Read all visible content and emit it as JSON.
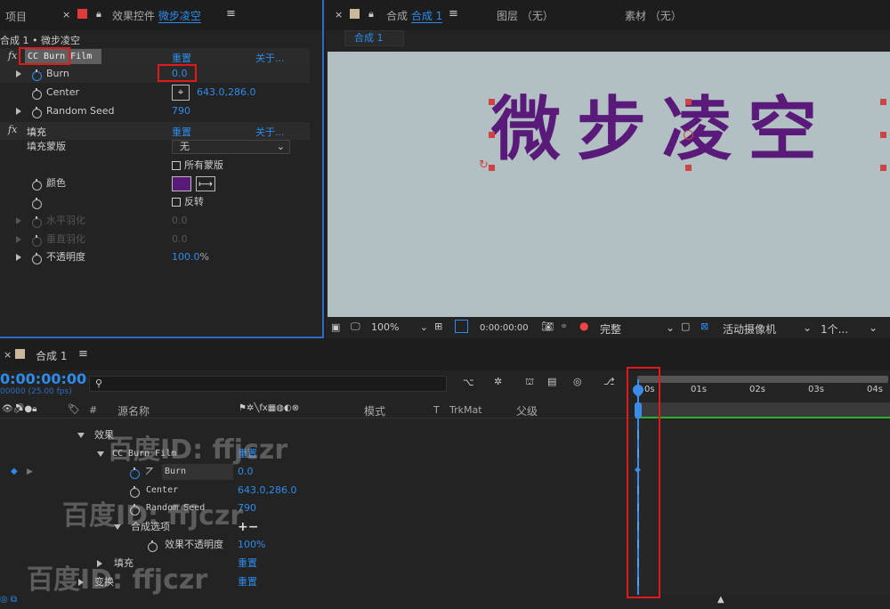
{
  "left_panel": {
    "tab_project": "项目",
    "tab_effects": "效果控件",
    "tab_effects_layer": "微步凌空",
    "breadcrumb": "合成 1 • 微步凌空",
    "fx_label": "fx",
    "effect1_name": "CC Burn Film",
    "reset": "重置",
    "about": "关于...",
    "burn_label": "Burn",
    "burn_value": "0.0",
    "center_label": "Center",
    "center_value": "643.0,286.0",
    "seed_label": "Random Seed",
    "seed_value": "790",
    "effect2_name": "填充",
    "mask_label": "填充蒙版",
    "mask_value": "无",
    "all_masks": "所有蒙版",
    "color_label": "颜色",
    "invert": "反转",
    "h_feather": "水平羽化",
    "h_feather_value": "0.0",
    "v_feather": "垂直羽化",
    "v_feather_value": "0.0",
    "opacity_label": "不透明度",
    "opacity_value": "100.0",
    "opacity_unit": "%",
    "fill_color": "#5a1a7a"
  },
  "comp_panel": {
    "tab_prefix": "合成",
    "tab_comp": "合成 1",
    "tab_layer": "图层 （无）",
    "tab_footage": "素材 （无）",
    "subtab": "合成 1",
    "canvas_text": "微步凌空",
    "zoom": "100%",
    "timecode": "0:00:00:00",
    "resolution": "完整",
    "camera": "活动摄像机",
    "views": "1个...",
    "text_color": "#5a1a7a",
    "canvas_bg": "#b3c0c3"
  },
  "timeline": {
    "tab": "合成 1",
    "timecode": "0:00:00:00",
    "fps": "00000 (25.00 fps)",
    "search_placeholder": "",
    "col_source": "源名称",
    "col_mode": "模式",
    "col_t": "T",
    "col_trkmat": "TrkMat",
    "col_parent": "父级",
    "ruler": [
      "0s",
      "01s",
      "02s",
      "03s",
      "04s"
    ],
    "rows": {
      "effects": "效果",
      "burn_film": "CC Burn Film",
      "burn": "Burn",
      "center": "Center",
      "seed": "Random Seed",
      "composite": "合成选项",
      "eff_opacity": "效果不透明度",
      "fill": "填充",
      "transform": "变换"
    },
    "values": {
      "reset1": "重置",
      "burn": "0.0",
      "center": "643.0,286.0",
      "seed": "790",
      "plusminus": "+−",
      "eff_opacity": "100%",
      "reset2": "重置",
      "reset3": "重置"
    }
  },
  "watermark": "百度ID: ffjczr"
}
